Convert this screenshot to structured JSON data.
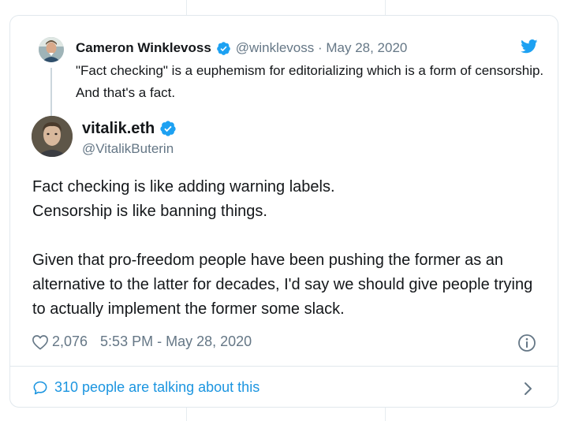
{
  "colors": {
    "accent": "#1da1f2",
    "link": "#1b95e0",
    "text": "#14171a",
    "muted": "#657786",
    "border": "#e1e8ed"
  },
  "quoted_tweet": {
    "author_name": "Cameron Winklevoss",
    "handle_date": "@winklevoss · May 28, 2020",
    "text": "\"Fact checking\" is a euphemism for editorializing which is a form of censorship. And that's a fact.",
    "avatar_icon": "user-avatar",
    "verified_icon": "verified-badge-icon"
  },
  "tweet": {
    "author_name": "vitalik.eth",
    "handle": "@VitalikButerin",
    "paragraphs": [
      "Fact checking is like adding warning labels.",
      "Censorship is like banning things.",
      "",
      "Given that pro-freedom people have been pushing the former as an alternative to the latter for decades, I'd say we should give people trying to actually implement the former some slack."
    ],
    "like_count": "2,076",
    "timestamp": "5:53 PM - May 28, 2020"
  },
  "footer": {
    "talking_label": "310 people are talking about this"
  },
  "icons": {
    "brand": "twitter-bird-icon",
    "like": "heart-icon",
    "info": "info-icon",
    "comment": "comment-icon",
    "more": "chevron-right-icon"
  }
}
